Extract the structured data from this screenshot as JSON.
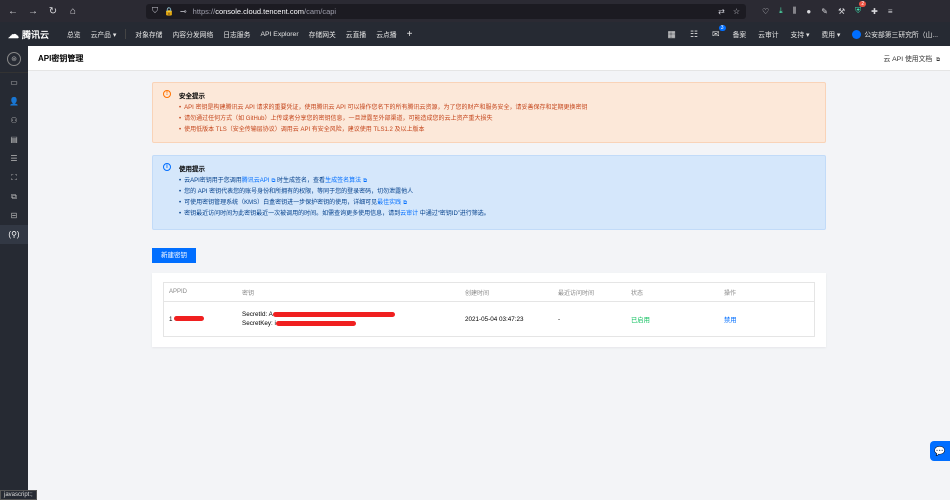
{
  "browser": {
    "url_proto": "https://",
    "url_host": "console.cloud.tencent.com",
    "url_path": "/cam/capi",
    "ext_badge": "2"
  },
  "topnav": {
    "logo": "腾讯云",
    "items": [
      "总览",
      "云产品 ▾",
      "对象存储",
      "内容分发网络",
      "日志服务",
      "API Explorer",
      "存储网关",
      "云直播",
      "云点播"
    ],
    "message_count": "3",
    "right_items": [
      "备案",
      "云审计",
      "支持 ▾",
      "费用 ▾"
    ],
    "user": "公安部第三研究所（山..."
  },
  "page": {
    "title": "API密钥管理",
    "doc_link": "云 API 使用文档"
  },
  "security_alert": {
    "title": "安全提示",
    "items": [
      "API 密钥是构建腾讯云 API 请求的重要凭证，使用腾讯云 API 可以操作您名下的所有腾讯云资源，为了您的财产和服务安全，请妥善保存和定期更换密钥",
      "请勿通过任何方式（如 GitHub）上传或者分享您的密钥信息，一旦泄露至外部渠道，可能造成您的云上资产重大损失",
      "使用低版本 TLS（安全传输层协议）调用云 API 有安全风险，建议使用 TLS1.2 及以上版本"
    ]
  },
  "usage_alert": {
    "title": "使用提示",
    "item1_pre": "云API密钥用于您调用",
    "item1_link1": "腾讯云API",
    "item1_mid": " 时生成签名，查看",
    "item1_link2": "生成签名算法",
    "item2": "您的 API 密钥代表您的账号身份和所拥有的权限，等同于您的登录密码，切勿泄露他人",
    "item3_pre": "可使用密钥管理系统（KMS）白盒密钥进一步保护密钥的使用，详细可见",
    "item3_link": "最佳实践",
    "item4_pre": "密钥最近访问时间为此密钥最近一次被调用的时间。如需查询更多使用信息，请到",
    "item4_link": "云审计",
    "item4_post": " 中通过“密钥ID”进行筛选。"
  },
  "create_button": "新建密钥",
  "table": {
    "headers": [
      "APPID",
      "密钥",
      "创建时间",
      "最近访问时间",
      "状态",
      "操作"
    ],
    "rows": [
      {
        "appid": "1",
        "secret_id_label": "SecretId: A",
        "secret_key_label": "SecretKey: i",
        "created": "2021-05-04 03:47:23",
        "last_access": "-",
        "status": "已启用",
        "action": "禁用"
      }
    ]
  },
  "status_tip": "javascript:;",
  "colors": {
    "primary": "#006eff",
    "success": "#0abf5b",
    "warning_bg": "#fce8d9",
    "info_bg": "#d5e7fb",
    "nav_bg": "#262a33"
  }
}
